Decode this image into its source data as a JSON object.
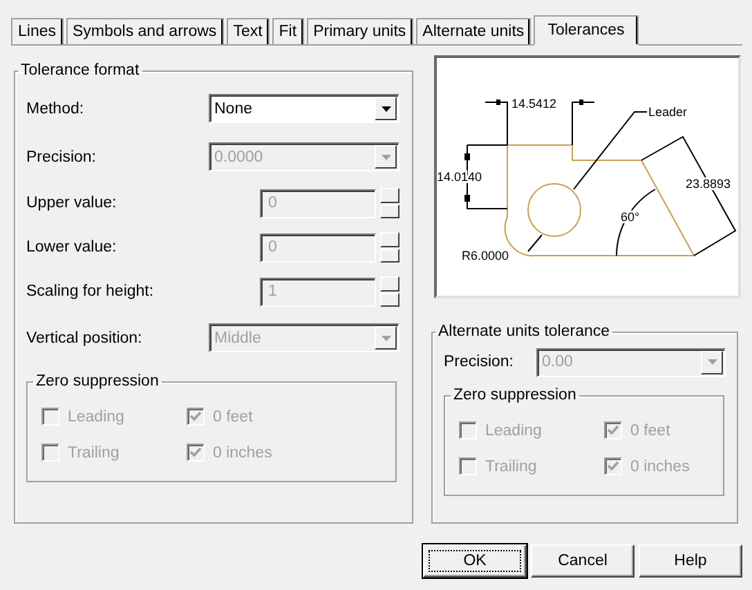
{
  "tabs": [
    {
      "label": "Lines",
      "selected": false
    },
    {
      "label": "Symbols and arrows",
      "selected": false
    },
    {
      "label": "Text",
      "selected": false
    },
    {
      "label": "Fit",
      "selected": false
    },
    {
      "label": "Primary units",
      "selected": false
    },
    {
      "label": "Alternate units",
      "selected": false
    },
    {
      "label": "Tolerances",
      "selected": true
    }
  ],
  "tolerance_format": {
    "title": "Tolerance format",
    "fields": [
      {
        "kind": "select",
        "label": "Method:",
        "value": "None",
        "disabled": false
      },
      {
        "kind": "select",
        "label": "Precision:",
        "value": "0.0000",
        "disabled": true
      },
      {
        "kind": "spin",
        "label": "Upper value:",
        "value": "0",
        "disabled": true
      },
      {
        "kind": "spin",
        "label": "Lower value:",
        "value": "0",
        "disabled": true
      },
      {
        "kind": "spin",
        "label": "Scaling for height:",
        "value": "1",
        "disabled": true
      },
      {
        "kind": "wideselect",
        "label": "Vertical position:",
        "value": "Middle",
        "disabled": true
      }
    ],
    "zero_suppression": {
      "title": "Zero suppression",
      "options": [
        {
          "label": "Leading",
          "checked": false,
          "disabled": true
        },
        {
          "label": "0 feet",
          "checked": true,
          "disabled": true
        },
        {
          "label": "Trailing",
          "checked": false,
          "disabled": true
        },
        {
          "label": "0 inches",
          "checked": true,
          "disabled": true
        }
      ]
    }
  },
  "preview": {
    "labels": [
      "14.5412",
      "Leader",
      "14.0140",
      "23.8893",
      "60°",
      "R6.0000"
    ]
  },
  "alternate_units_tolerance": {
    "title": "Alternate units tolerance",
    "precision": {
      "label": "Precision:",
      "value": "0.00",
      "disabled": true
    },
    "zero_suppression": {
      "title": "Zero suppression",
      "options": [
        {
          "label": "Leading",
          "checked": false,
          "disabled": true
        },
        {
          "label": "0 feet",
          "checked": true,
          "disabled": true
        },
        {
          "label": "Trailing",
          "checked": false,
          "disabled": true
        },
        {
          "label": "0 inches",
          "checked": true,
          "disabled": true
        }
      ]
    }
  },
  "buttons": [
    {
      "label": "OK",
      "default": true
    },
    {
      "label": "Cancel",
      "default": false
    },
    {
      "label": "Help",
      "default": false
    }
  ]
}
